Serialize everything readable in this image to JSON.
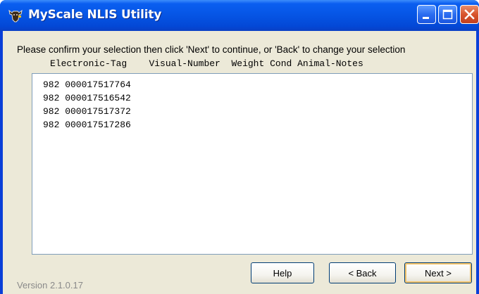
{
  "window": {
    "title": "MyScale NLIS Utility"
  },
  "instruction": "Please confirm your selection then click 'Next' to continue, or 'Back' to change your selection",
  "columns": [
    "Electronic-Tag",
    "Visual-Number",
    "Weight",
    "Cond",
    "Animal-Notes"
  ],
  "rows": [
    "982 000017517764",
    "982 000017516542",
    "982 000017517372",
    "982 000017517286"
  ],
  "buttons": {
    "help": "Help",
    "back": "< Back",
    "next": "Next >"
  },
  "version": "Version 2.1.0.17",
  "icons": {
    "app": "cattle-head-icon",
    "minimize": "minimize-icon",
    "maximize": "maximize-icon",
    "close": "close-icon"
  },
  "colors": {
    "titlebar": "#0656e6",
    "client": "#ece9d8",
    "close": "#d8542c",
    "default_button_ring": "#f4c469"
  }
}
